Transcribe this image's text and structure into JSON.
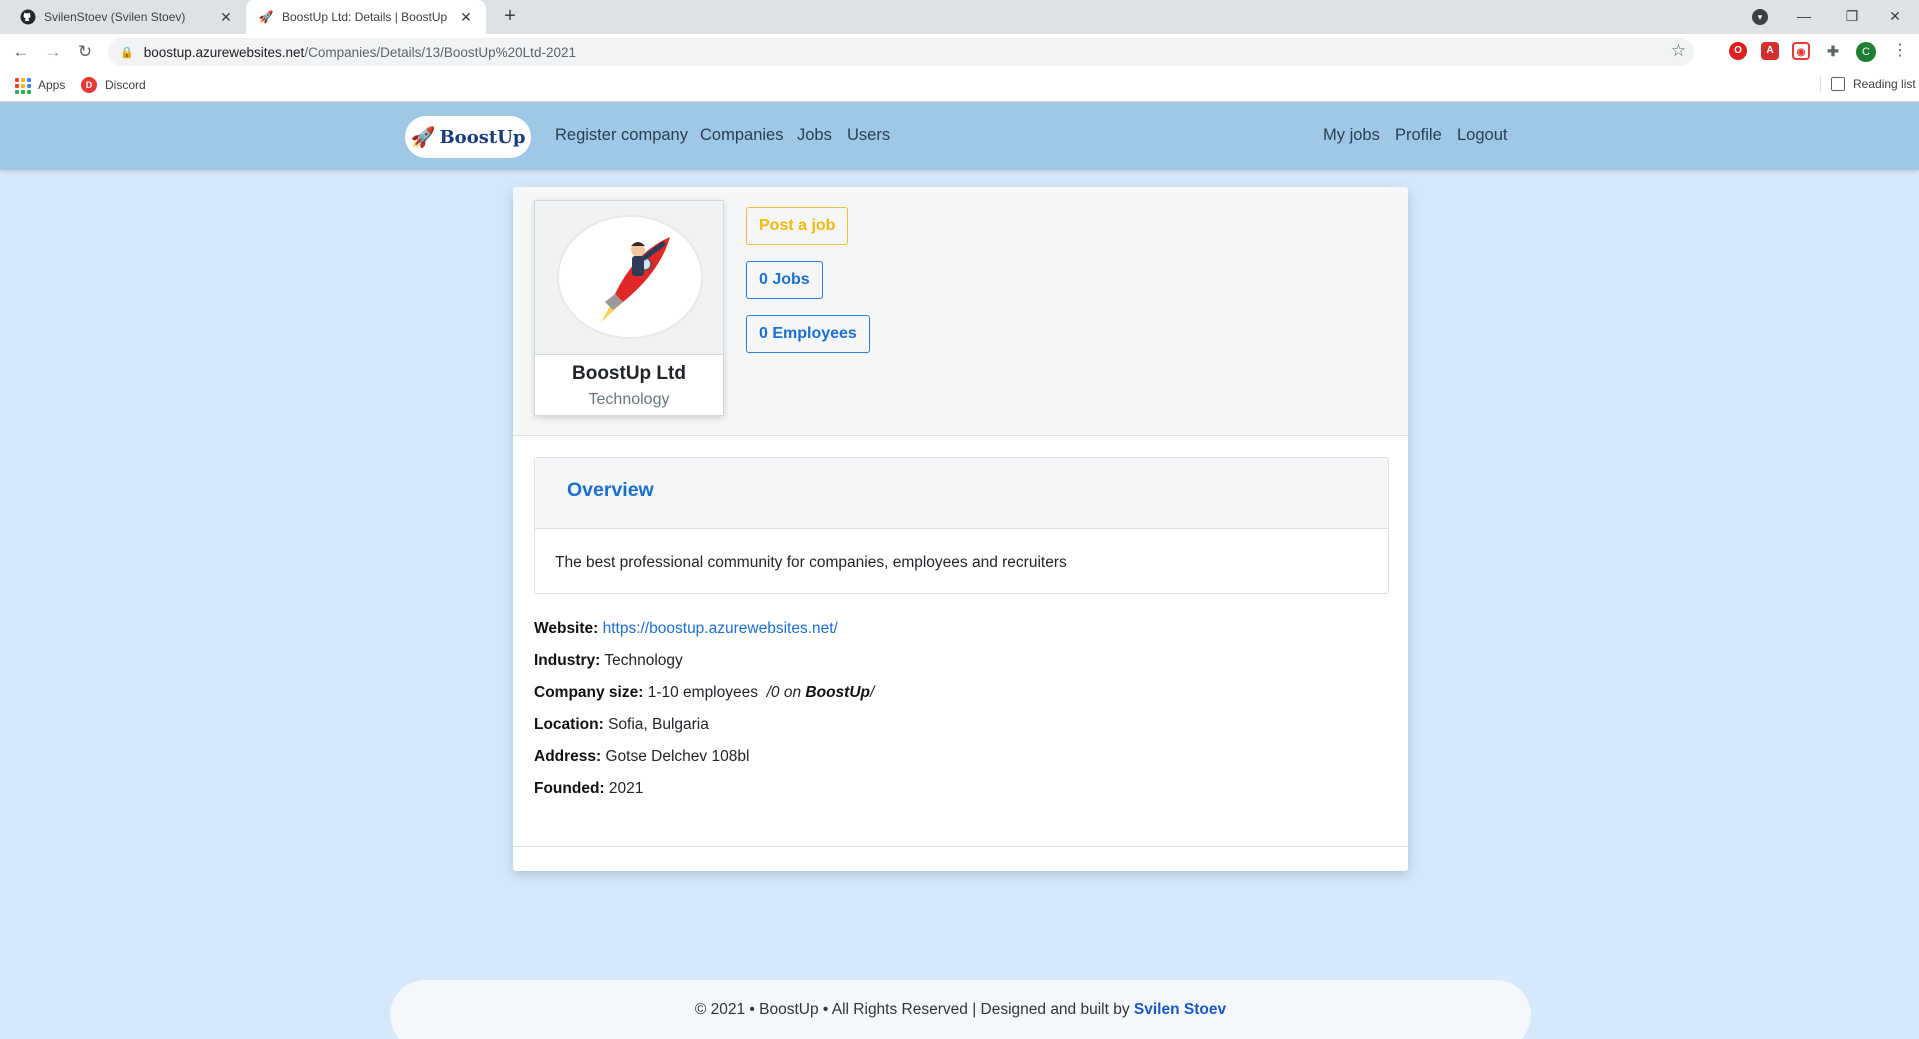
{
  "browser": {
    "tabs": [
      {
        "title": "SvilenStoev (Svilen Stoev)",
        "favicon": "github-icon",
        "active": false
      },
      {
        "title": "BoostUp Ltd: Details | BoostUp",
        "favicon": "rocket-icon",
        "active": true
      }
    ],
    "url_host": "boostup.azurewebsites.net",
    "url_path": "/Companies/Details/13/BoostUp%20Ltd-2021",
    "bookmarks": [
      {
        "label": "Apps",
        "icon": "apps-grid-icon"
      },
      {
        "label": "Discord",
        "icon": "discord-icon"
      }
    ],
    "reading_list": "Reading list",
    "profile_initial": "C"
  },
  "site": {
    "brand": "BoostUp",
    "nav_left": [
      "Register company",
      "Companies",
      "Jobs",
      "Users"
    ],
    "nav_right": [
      "My jobs",
      "Profile",
      "Logout"
    ]
  },
  "company": {
    "name": "BoostUp Ltd",
    "industry_tag": "Technology",
    "actions": {
      "post_job": "Post a job",
      "jobs": "0 Jobs",
      "employees": "0 Employees"
    },
    "overview_title": "Overview",
    "overview_text": "The best professional community for companies, employees and recruiters",
    "details": {
      "website_label": "Website:",
      "website_value": "https://boostup.azurewebsites.net/",
      "industry_label": "Industry:",
      "industry_value": "Technology",
      "size_label": "Company size:",
      "size_value": "1-10 employees",
      "size_prefix": "/0 on ",
      "size_brand": "BoostUp",
      "size_suffix": "/",
      "location_label": "Location:",
      "location_value": "Sofia, Bulgaria",
      "address_label": "Address:",
      "address_value": "Gotse Delchev 108bl",
      "founded_label": "Founded:",
      "founded_value": "2021"
    }
  },
  "footer": {
    "text": "© 2021 • BoostUp • All Rights Reserved | Designed and built by ",
    "author": "Svilen Stoev"
  },
  "colors": {
    "page_bg": "#d6e9fb",
    "navbar_bg": "#9fc8e6",
    "accent_blue": "#1a6fd1",
    "accent_yellow": "#f0b90b"
  }
}
